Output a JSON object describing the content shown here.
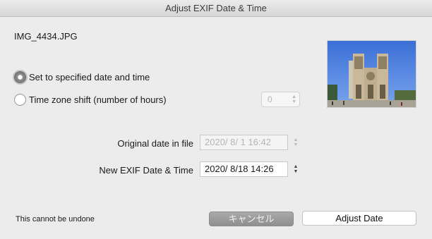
{
  "window": {
    "title": "Adjust EXIF Date & Time"
  },
  "file": {
    "name": "IMG_4434.JPG"
  },
  "options": {
    "set_specified": {
      "label": "Set to specified date and time",
      "selected": true
    },
    "timezone_shift": {
      "label": "Time zone shift (number of hours)",
      "selected": false,
      "value": "0"
    }
  },
  "fields": {
    "original": {
      "label": "Original date in file",
      "value": "2020/  8/  1 16:42"
    },
    "new": {
      "label": "New EXIF Date & Time",
      "value": "2020/  8/18 14:26"
    }
  },
  "footer": {
    "note": "This cannot be undone"
  },
  "buttons": {
    "cancel": "キャンセル",
    "adjust": "Adjust Date"
  },
  "icons": {
    "stepper_up": "▲",
    "stepper_down": "▼",
    "select_arrows": "chevron-up-down-icon",
    "thumbnail": "photo-thumbnail"
  }
}
